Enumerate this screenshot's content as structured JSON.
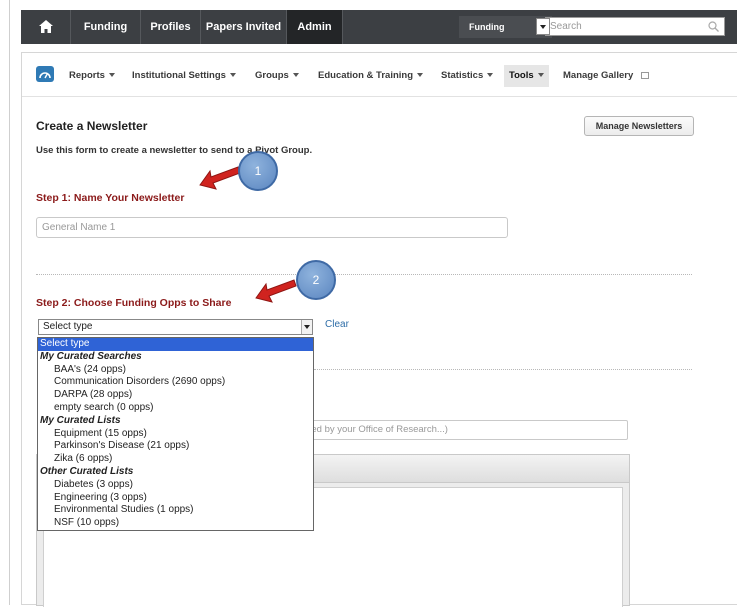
{
  "topnav": {
    "items": [
      "Funding",
      "Profiles",
      "Papers Invited",
      "Admin"
    ],
    "search_scope": "Funding",
    "search_placeholder": "Search"
  },
  "subnav": {
    "items": [
      {
        "label": "Reports",
        "dropdown": true
      },
      {
        "label": "Institutional Settings",
        "dropdown": true
      },
      {
        "label": "Groups",
        "dropdown": true
      },
      {
        "label": "Education & Training",
        "dropdown": true
      },
      {
        "label": "Statistics",
        "dropdown": true
      },
      {
        "label": "Tools",
        "dropdown": true,
        "active": true
      },
      {
        "label": "Manage Gallery",
        "dropdown": false
      }
    ]
  },
  "page": {
    "title": "Create a Newsletter",
    "manage_button": "Manage Newsletters",
    "intro": "Use this form to create a newsletter to send to a Pivot Group.",
    "step1_title": "Step 1: Name Your Newsletter",
    "name_placeholder": "General Name 1",
    "step2_title": "Step 2: Choose Funding Opps to Share",
    "select_value": "Select type",
    "clear_label": "Clear",
    "group_placeholder": "urated by your Office of Research...)"
  },
  "dropdown": {
    "selected": "Select type",
    "groups": [
      {
        "label": "My Curated Searches",
        "options": [
          "BAA's (24 opps)",
          "Communication Disorders (2690 opps)",
          "DARPA (28 opps)",
          "empty search (0 opps)"
        ]
      },
      {
        "label": "My Curated Lists",
        "options": [
          "Equipment (15 opps)",
          "Parkinson's Disease (21 opps)",
          "Zika (6 opps)"
        ]
      },
      {
        "label": "Other Curated Lists",
        "options": [
          "Diabetes (3 opps)",
          "Engineering (3 opps)",
          "Environmental Studies (1 opps)",
          "NSF (10 opps)"
        ]
      }
    ]
  },
  "annotations": {
    "badge1": "1",
    "badge2": "2"
  },
  "colors": {
    "nav_bg": "#3c3f43",
    "step_title": "#8b1a1a",
    "link": "#2f6ea8",
    "selection": "#2f63d6",
    "badge": "#6a93cc",
    "arrow": "#d0231f"
  }
}
